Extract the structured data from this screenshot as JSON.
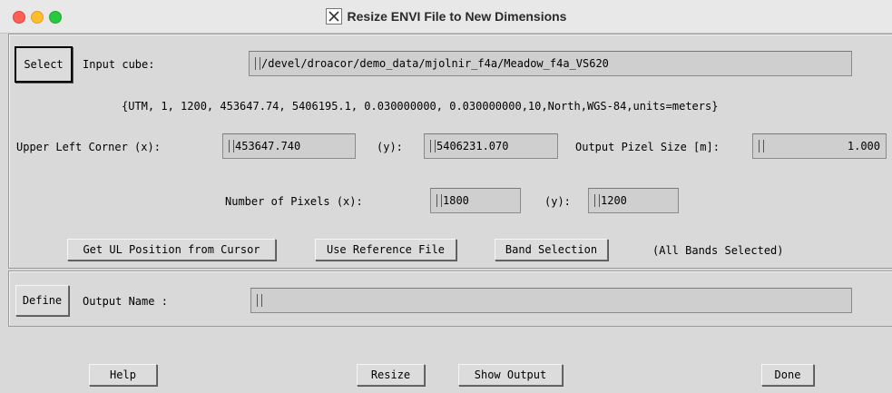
{
  "window": {
    "title": "Resize ENVI File to New Dimensions"
  },
  "input": {
    "select_label": "Select",
    "label": "Input cube:",
    "value": "/devel/droacor/demo_data/mjolnir_f4a/Meadow_f4a_VS620",
    "map_info": "{UTM, 1, 1200, 453647.74, 5406195.1, 0.030000000, 0.030000000,10,North,WGS-84,units=meters}"
  },
  "corner": {
    "x_label": "Upper Left Corner (x):",
    "x_value": "453647.740",
    "y_label": "(y):",
    "y_value": "5406231.070",
    "pixel_size_label": "Output Pizel Size [m]:",
    "pixel_size_value": "1.000"
  },
  "pixels": {
    "x_label": "Number of Pixels (x):",
    "x_value": "1800",
    "y_label": "(y):",
    "y_value": "1200"
  },
  "actions": {
    "get_ul": "Get UL Position from Cursor",
    "use_ref": "Use Reference File",
    "band_sel": "Band Selection",
    "band_status": "(All Bands Selected)"
  },
  "output": {
    "define_label": "Define",
    "label": "Output Name :",
    "value": ""
  },
  "footer": {
    "help": "Help",
    "resize": "Resize",
    "show_output": "Show Output",
    "done": "Done"
  }
}
